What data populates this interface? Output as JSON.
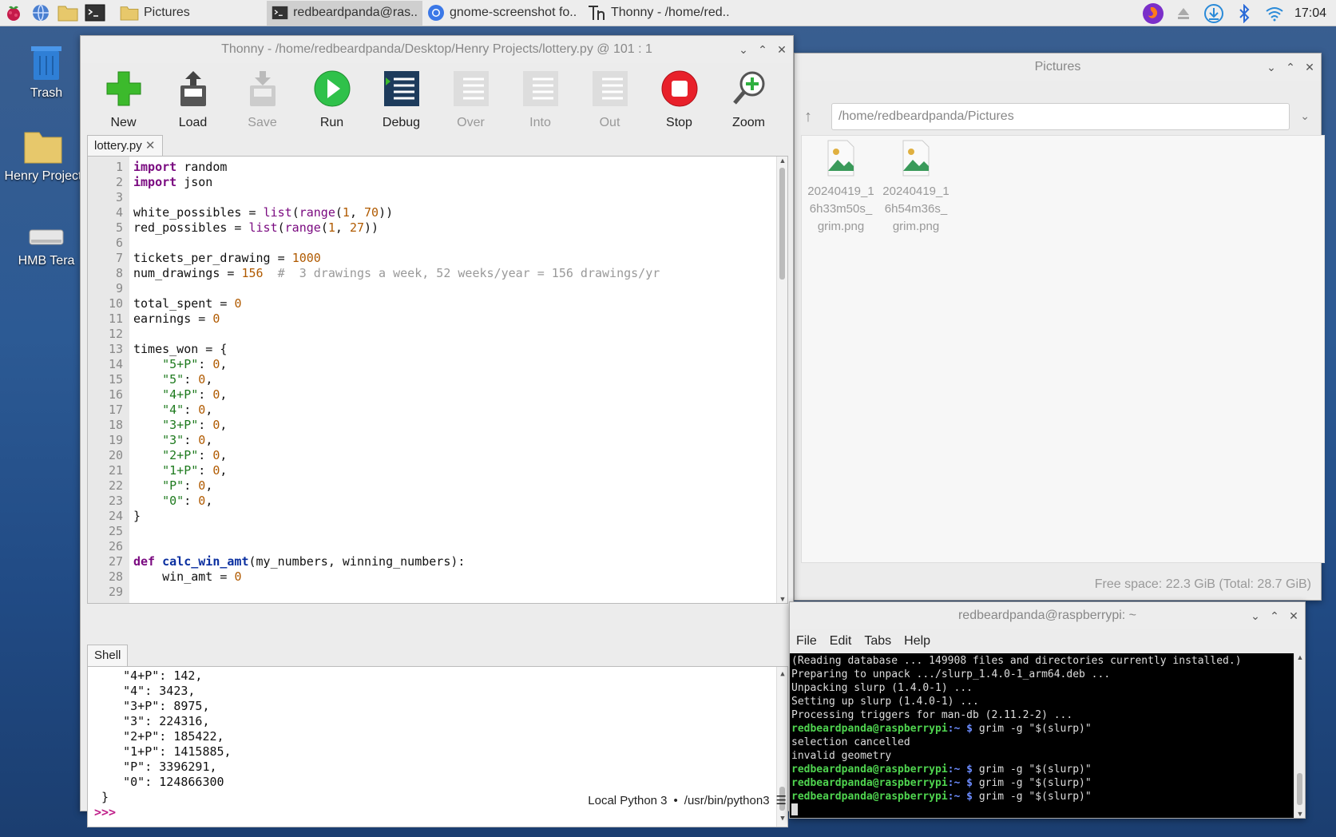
{
  "taskbar": {
    "tasks": [
      {
        "label": "Pictures"
      },
      {
        "label": "redbeardpanda@ras.."
      },
      {
        "label": "gnome-screenshot fo.."
      },
      {
        "label": "Thonny  -  /home/red.."
      }
    ],
    "clock": "17:04",
    "colors": {
      "accent": "#2c5a94"
    }
  },
  "desktop": {
    "icons": [
      {
        "label": "Trash",
        "icon": "trash-icon"
      },
      {
        "label": "Henry Project",
        "icon": "folder-icon"
      },
      {
        "label": "HMB Tera",
        "icon": "drive-icon"
      }
    ]
  },
  "thonny": {
    "title": "Thonny  -  /home/redbeardpanda/Desktop/Henry Projects/lottery.py  @  101 : 1",
    "toolbar": [
      "New",
      "Load",
      "Save",
      "Run",
      "Debug",
      "Over",
      "Into",
      "Out",
      "Stop",
      "Zoom"
    ],
    "tab": "lottery.py",
    "shell_tab": "Shell",
    "line_numbers": [
      "1",
      "2",
      "3",
      "4",
      "5",
      "6",
      "7",
      "8",
      "9",
      "10",
      "11",
      "12",
      "13",
      "14",
      "15",
      "16",
      "17",
      "18",
      "19",
      "20",
      "21",
      "22",
      "23",
      "24",
      "25",
      "26",
      "27",
      "28",
      "29"
    ],
    "shell_lines": [
      "    \"4+P\": 142,",
      "    \"4\": 3423,",
      "    \"3+P\": 8975,",
      "    \"3\": 224316,",
      "    \"2+P\": 185422,",
      "    \"1+P\": 1415885,",
      "    \"P\": 3396291,",
      "    \"0\": 124866300",
      " }"
    ],
    "shell_prompt": ">>>",
    "status_interpreter": "Local Python 3",
    "status_sep": "•",
    "status_path": "/usr/bin/python3"
  },
  "file_manager": {
    "title": "Pictures",
    "path": "/home/redbeardpanda/Pictures",
    "files": [
      {
        "name": "20240419_1 6h33m50s_ grim.png"
      },
      {
        "name": "20240419_1 6h54m36s_ grim.png"
      }
    ],
    "status": "Free space: 22.3 GiB (Total: 28.7 GiB)"
  },
  "terminal": {
    "title": "redbeardpanda@raspberrypi: ~",
    "menu": [
      "File",
      "Edit",
      "Tabs",
      "Help"
    ],
    "lines": [
      "(Reading database ... 149908 files and directories currently installed.)",
      "Preparing to unpack .../slurp_1.4.0-1_arm64.deb ...",
      "Unpacking slurp (1.4.0-1) ...",
      "Setting up slurp (1.4.0-1) ...",
      "Processing triggers for man-db (2.11.2-2) ...",
      "selection cancelled",
      "invalid geometry"
    ],
    "prompt_user": "redbeardpanda@raspberrypi",
    "prompt_path": ":~ $",
    "command": "grim -g \"$(slurp)\""
  }
}
